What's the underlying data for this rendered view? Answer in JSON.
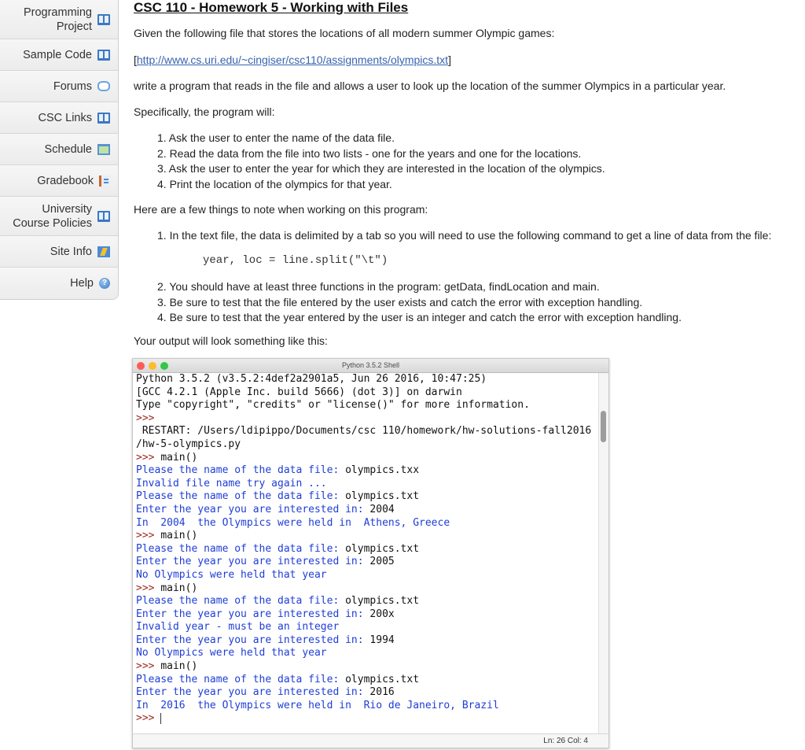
{
  "sidebar": {
    "items": [
      {
        "label": "Programming Project",
        "icon": "book-icon"
      },
      {
        "label": "Sample Code",
        "icon": "book-icon"
      },
      {
        "label": "Forums",
        "icon": "forum-icon"
      },
      {
        "label": "CSC Links",
        "icon": "book-icon"
      },
      {
        "label": "Schedule",
        "icon": "calendar-icon"
      },
      {
        "label": "Gradebook",
        "icon": "gradebook-icon"
      },
      {
        "label": "University Course Policies",
        "icon": "book-icon"
      },
      {
        "label": "Site Info",
        "icon": "site-info-icon"
      },
      {
        "label": "Help",
        "icon": "help-icon"
      }
    ]
  },
  "main": {
    "title": "CSC 110 - Homework 5 - Working with Files",
    "intro": "Given the following file that stores the locations of all modern summer Olympic games:",
    "link_open": "[",
    "link_url": "http://www.cs.uri.edu/~cingiser/csc110/assignments/olympics.txt",
    "link_close": "]",
    "task": "write a program that reads in the file and allows a user to look up the location of the summer Olympics in a particular year.",
    "specifically": "Specifically, the program will:",
    "steps": [
      "1. Ask the user to enter the name of the data file.",
      "2. Read the data from the file into two lists - one for the years and one for the locations.",
      "3. Ask the user to enter the year for which they are interested in the location of the olympics.",
      "4. Print the location of the olympics for that year."
    ],
    "notes_heading": "Here are a few things to note when working on this program:",
    "note1": "1. In the text file, the data is delimited by a tab so you will need to use the following command to get a line of data from the file:",
    "code_line": "year, loc = line.split(\"\\t\")",
    "notes_rest": [
      "2. You should have at least three functions in the program:  getData, findLocation and main.",
      "3. Be sure to test that the file entered by the user exists and catch the error with exception handling.",
      "4. Be sure to test that the year entered by the user is an integer and catch the error with exception handling."
    ],
    "output_heading": "Your output will look something like this:"
  },
  "shell": {
    "title": "Python 3.5.2 Shell",
    "status": "Ln: 26  Col: 4",
    "lines": [
      [
        {
          "t": "Python 3.5.2 (v3.5.2:4def2a2901a5, Jun 26 2016, 10:47:25)",
          "c": "in"
        }
      ],
      [
        {
          "t": "[GCC 4.2.1 (Apple Inc. build 5666) (dot 3)] on darwin",
          "c": "in"
        }
      ],
      [
        {
          "t": "Type \"copyright\", \"credits\" or \"license()\" for more information.",
          "c": "in"
        }
      ],
      [
        {
          "t": ">>>",
          "c": "prompt"
        }
      ],
      [
        {
          "t": " RESTART: /Users/ldipippo/Documents/csc 110/homework/hw-solutions-fall2016",
          "c": "in"
        }
      ],
      [
        {
          "t": "/hw-5-olympics.py",
          "c": "in"
        }
      ],
      [
        {
          "t": ">>> ",
          "c": "prompt"
        },
        {
          "t": "main()",
          "c": "in"
        }
      ],
      [
        {
          "t": "Please the name of the data file: ",
          "c": "out"
        },
        {
          "t": "olympics.txx",
          "c": "in"
        }
      ],
      [
        {
          "t": "Invalid file name try again ...",
          "c": "out"
        }
      ],
      [
        {
          "t": "Please the name of the data file: ",
          "c": "out"
        },
        {
          "t": "olympics.txt",
          "c": "in"
        }
      ],
      [
        {
          "t": "Enter the year you are interested in: ",
          "c": "out"
        },
        {
          "t": "2004",
          "c": "in"
        }
      ],
      [
        {
          "t": "In  2004  the Olympics were held in  Athens, Greece",
          "c": "out"
        }
      ],
      [
        {
          "t": ">>> ",
          "c": "prompt"
        },
        {
          "t": "main()",
          "c": "in"
        }
      ],
      [
        {
          "t": "Please the name of the data file: ",
          "c": "out"
        },
        {
          "t": "olympics.txt",
          "c": "in"
        }
      ],
      [
        {
          "t": "Enter the year you are interested in: ",
          "c": "out"
        },
        {
          "t": "2005",
          "c": "in"
        }
      ],
      [
        {
          "t": "No Olympics were held that year",
          "c": "out"
        }
      ],
      [
        {
          "t": ">>> ",
          "c": "prompt"
        },
        {
          "t": "main()",
          "c": "in"
        }
      ],
      [
        {
          "t": "Please the name of the data file: ",
          "c": "out"
        },
        {
          "t": "olympics.txt",
          "c": "in"
        }
      ],
      [
        {
          "t": "Enter the year you are interested in: ",
          "c": "out"
        },
        {
          "t": "200x",
          "c": "in"
        }
      ],
      [
        {
          "t": "Invalid year - must be an integer",
          "c": "out"
        }
      ],
      [
        {
          "t": "Enter the year you are interested in: ",
          "c": "out"
        },
        {
          "t": "1994",
          "c": "in"
        }
      ],
      [
        {
          "t": "No Olympics were held that year",
          "c": "out"
        }
      ],
      [
        {
          "t": ">>> ",
          "c": "prompt"
        },
        {
          "t": "main()",
          "c": "in"
        }
      ],
      [
        {
          "t": "Please the name of the data file: ",
          "c": "out"
        },
        {
          "t": "olympics.txt",
          "c": "in"
        }
      ],
      [
        {
          "t": "Enter the year you are interested in: ",
          "c": "out"
        },
        {
          "t": "2016",
          "c": "in"
        }
      ],
      [
        {
          "t": "In  2016  the Olympics were held in  Rio de Janeiro, Brazil",
          "c": "out"
        }
      ],
      [
        {
          "t": ">>> ",
          "c": "prompt"
        }
      ]
    ]
  }
}
